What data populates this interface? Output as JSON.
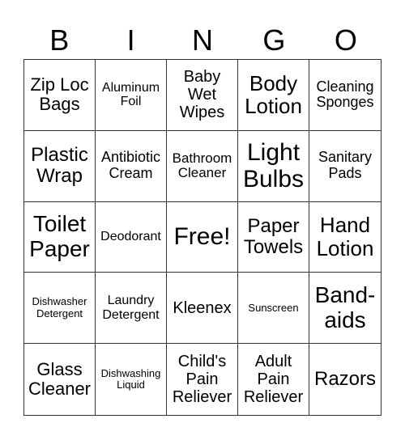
{
  "header": [
    "B",
    "I",
    "N",
    "G",
    "O"
  ],
  "cells": [
    "Zip Loc Bags",
    "Aluminum Foil",
    "Baby Wet Wipes",
    "Body Lotion",
    "Cleaning Sponges",
    "Plastic Wrap",
    "Antibiotic Cream",
    "Bathroom Cleaner",
    "Light Bulbs",
    "Sanitary Pads",
    "Toilet Paper",
    "Deodorant",
    "Free!",
    "Paper Towels",
    "Hand Lotion",
    "Dishwasher Detergent",
    "Laundry Detergent",
    "Kleenex",
    "Sunscreen",
    "Band-aids",
    "Glass Cleaner",
    "Dishwashing Liquid",
    "Child's Pain Reliever",
    "Adult Pain Reliever",
    "Razors"
  ]
}
